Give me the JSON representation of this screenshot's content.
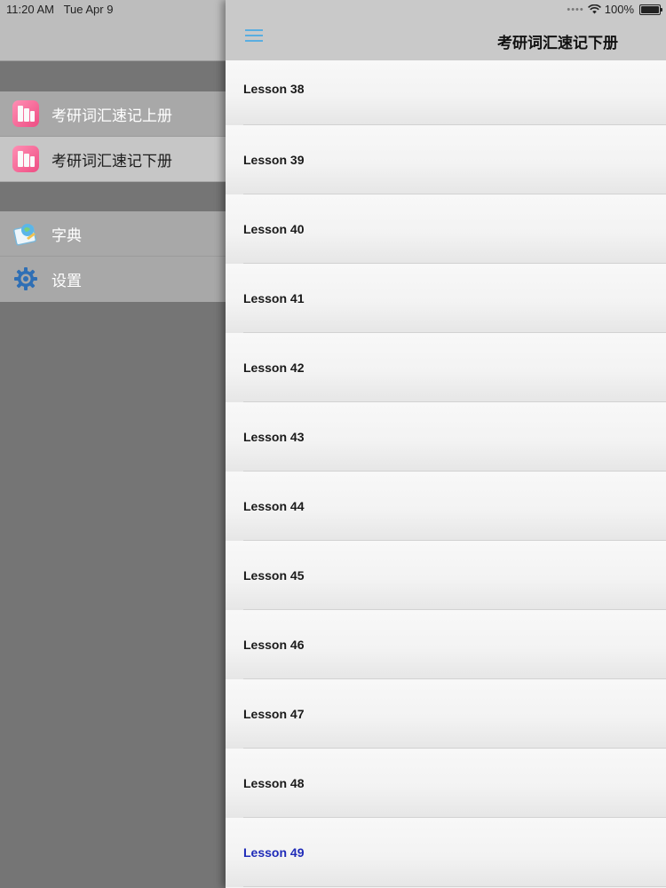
{
  "status_bar": {
    "time": "11:20 AM",
    "date": "Tue Apr 9",
    "signal": "••••",
    "battery": "100%"
  },
  "sidebar": {
    "books": [
      {
        "label": "考研词汇速记上册",
        "icon": "book-icon",
        "selected": false
      },
      {
        "label": "考研词汇速记下册",
        "icon": "book-icon",
        "selected": true
      }
    ],
    "tools": [
      {
        "label": "字典",
        "icon": "dictionary-icon"
      },
      {
        "label": "设置",
        "icon": "gear-icon"
      }
    ]
  },
  "navbar": {
    "menu_icon": "hamburger-menu-icon",
    "title": "考研词汇速记下册"
  },
  "lessons": [
    "Lesson 38",
    "Lesson 39",
    "Lesson 40",
    "Lesson 41",
    "Lesson 42",
    "Lesson 43",
    "Lesson 44",
    "Lesson 45",
    "Lesson 46",
    "Lesson 47",
    "Lesson 48",
    "Lesson 49"
  ],
  "colors": {
    "accent": "#5aaee0",
    "active_lesson": "#1f2bb8",
    "book_icon": "#ee4d83"
  }
}
